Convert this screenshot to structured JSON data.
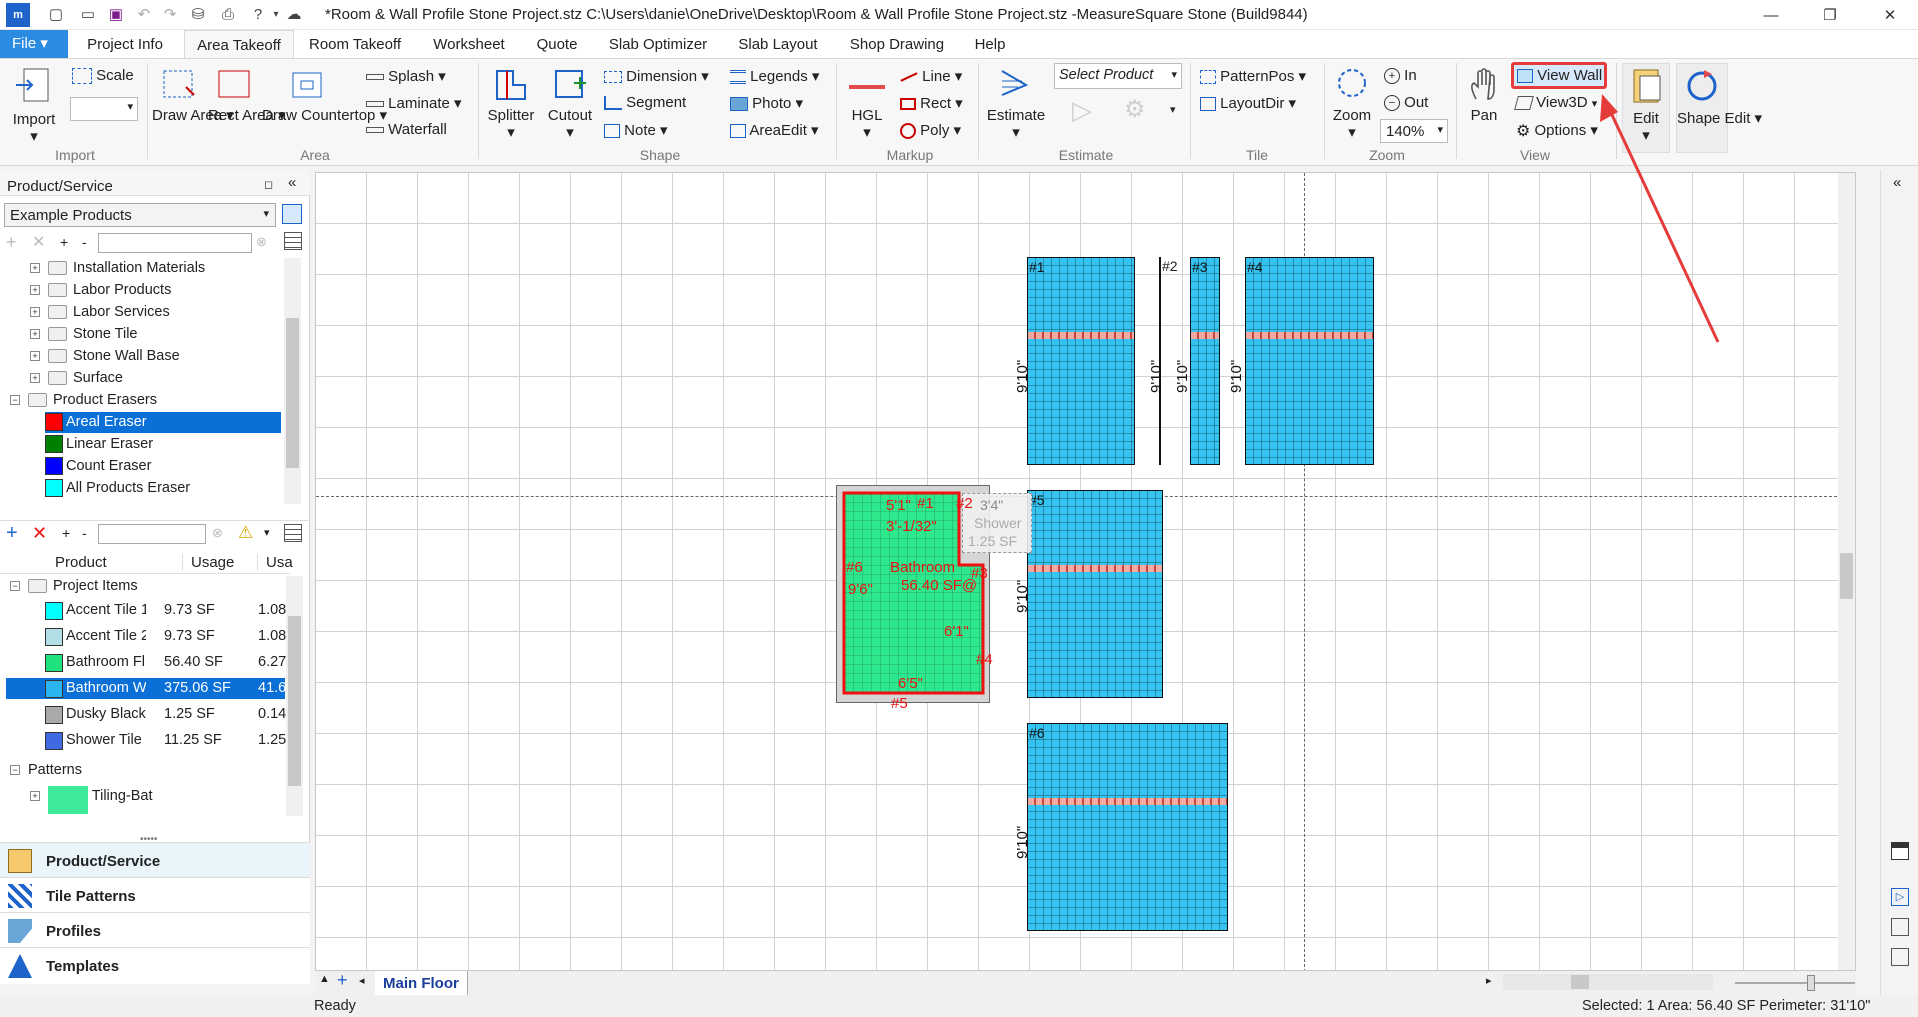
{
  "window": {
    "title": "*Room & Wall Profile Stone Project.stz C:\\Users\\danie\\OneDrive\\Desktop\\Room & Wall Profile Stone Project.stz -MeasureSquare Stone (Build9844)"
  },
  "tabs": {
    "file": "File",
    "items": [
      "Project Info",
      "Area Takeoff",
      "Room Takeoff",
      "Worksheet",
      "Quote",
      "Slab Optimizer",
      "Slab Layout",
      "Shop Drawing",
      "Help"
    ],
    "active": "Area Takeoff"
  },
  "ribbon": {
    "import": "Import",
    "scale": "Scale",
    "draw_area": "Draw Area",
    "rect_area": "Rect Area",
    "draw_countertop": "Draw Countertop",
    "splash": "Splash",
    "laminate": "Laminate",
    "waterfall": "Waterfall",
    "splitter": "Splitter",
    "cutout": "Cutout",
    "dimension": "Dimension",
    "segment": "Segment",
    "note": "Note",
    "legends": "Legends",
    "photo": "Photo",
    "area_edit": "AreaEdit",
    "hgl": "HGL",
    "line": "Line",
    "rect": "Rect",
    "poly": "Poly",
    "estimate": "Estimate",
    "select_product": "Select Product",
    "pattern_pos": "PatternPos",
    "layout_dir": "LayoutDir",
    "zoom": "Zoom",
    "zoom_in": "In",
    "zoom_out": "Out",
    "zoom_level": "140%",
    "pan": "Pan",
    "view_wall": "View Wall",
    "view3d": "View3D",
    "options": "Options",
    "edit": "Edit",
    "shape_edit": "Shape Edit",
    "groups": {
      "import": "Import",
      "area": "Area",
      "shape": "Shape",
      "markup": "Markup",
      "estimate": "Estimate",
      "tile": "Tile",
      "zoom": "Zoom",
      "view": "View"
    }
  },
  "left_panel": {
    "title": "Product/Service",
    "combo": "Example Products",
    "tree": [
      {
        "label": "Installation Materials",
        "type": "folder"
      },
      {
        "label": "Labor Products",
        "type": "folder"
      },
      {
        "label": "Labor Services",
        "type": "folder"
      },
      {
        "label": "Stone Tile",
        "type": "folder"
      },
      {
        "label": "Stone Wall Base",
        "type": "folder"
      },
      {
        "label": "Surface",
        "type": "folder"
      }
    ],
    "erasers_folder": "Product Erasers",
    "erasers": [
      {
        "label": "Areal Eraser",
        "color": "#ff0000"
      },
      {
        "label": "Linear Eraser",
        "color": "#008000"
      },
      {
        "label": "Count Eraser",
        "color": "#0000ff"
      },
      {
        "label": "All Products Eraser",
        "color": "#00ffff"
      }
    ],
    "grid_headers": [
      "Product",
      "Usage",
      "Usa"
    ],
    "project_items_label": "Project Items",
    "project_items": [
      {
        "name": "Accent Tile 1",
        "usage": "9.73 SF",
        "usa": "1.08",
        "color": "#00ffff"
      },
      {
        "name": "Accent Tile 2",
        "usage": "9.73 SF",
        "usa": "1.08",
        "color": "#b0e0e6"
      },
      {
        "name": "Bathroom Fl",
        "usage": "56.40 SF",
        "usa": "6.27",
        "color": "#1fe27c"
      },
      {
        "name": "Bathroom W",
        "usage": "375.06 SF",
        "usa": "41.6",
        "color": "#2ab4f0"
      },
      {
        "name": "Dusky Black",
        "usage": "1.25 SF",
        "usa": "0.14",
        "color": "#a9a9a9"
      },
      {
        "name": "Shower Tile",
        "usage": "11.25 SF",
        "usa": "1.25",
        "color": "#4169e1"
      }
    ],
    "patterns_label": "Patterns",
    "pattern_item": "Tiling-Bat",
    "nav": [
      "Product/Service",
      "Tile Patterns",
      "Profiles",
      "Templates"
    ]
  },
  "canvas": {
    "walls": [
      "#1",
      "#2",
      "#3",
      "#4",
      "#5",
      "#6"
    ],
    "wall_height": "9'10\"",
    "room": {
      "name": "Bathroom",
      "area": "56.40 SF@",
      "labels": [
        "5'1\"",
        "#1",
        "3'-1/32\"",
        "#2",
        "#3",
        "#4",
        "#5",
        "#6",
        "9'6\"",
        "6'1\"",
        "6'5\""
      ]
    },
    "shower": {
      "dim": "3'4\"",
      "label1": "Shower",
      "label2": "1.25 SF"
    }
  },
  "bottom": {
    "tab": "Main Floor"
  },
  "status": {
    "left": "Ready",
    "right": "Selected: 1 Area: 56.40 SF Perimeter: 31'10\""
  }
}
